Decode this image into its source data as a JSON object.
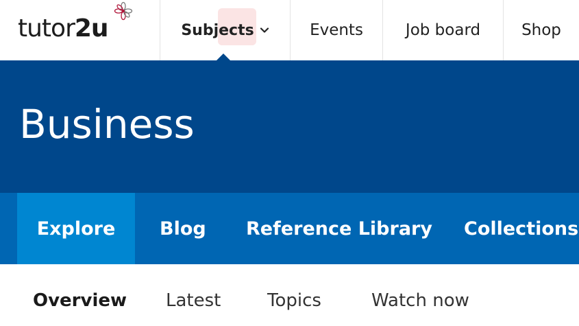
{
  "brand": {
    "logo_text_prefix": "tutor",
    "logo_text_suffix": "2u",
    "flower_colors": [
      "#b0163a",
      "#7a7a7a"
    ]
  },
  "topnav": {
    "items": [
      {
        "label": "Subjects",
        "has_dropdown": true,
        "active": true
      },
      {
        "label": "Events"
      },
      {
        "label": "Job board"
      },
      {
        "label": "Shop"
      }
    ]
  },
  "banner": {
    "title": "Business",
    "background": "#00478b"
  },
  "section_tabs": {
    "items": [
      {
        "label": "Explore",
        "active": true
      },
      {
        "label": "Blog"
      },
      {
        "label": "Reference Library"
      },
      {
        "label": "Collections"
      }
    ],
    "background": "#0066b3",
    "active_background": "#0086d1"
  },
  "subnav": {
    "items": [
      {
        "label": "Overview",
        "active": true
      },
      {
        "label": "Latest"
      },
      {
        "label": "Topics"
      },
      {
        "label": "Watch now"
      }
    ]
  }
}
